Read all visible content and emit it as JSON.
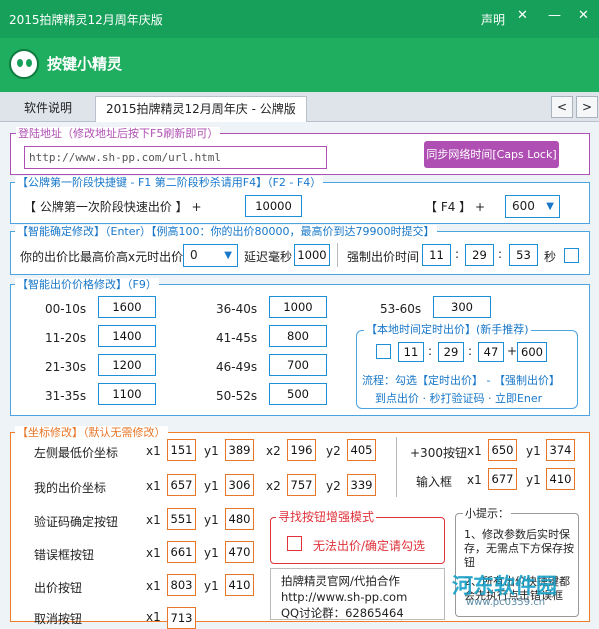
{
  "window": {
    "title": "2015拍牌精灵12月周年庆版",
    "menu": "声明"
  },
  "brand": {
    "name": "按键小精灵"
  },
  "tabs": [
    {
      "label": "软件说明"
    },
    {
      "label": "2015拍牌精灵12月周年庆 - 公牌版"
    }
  ],
  "nav": {
    "prev": "<",
    "next": ">"
  },
  "login": {
    "legend": "登陆地址（修改地址后按下F5刷新即可）",
    "url": "http://www.sh-pp.com/url.html",
    "sync_button": "同步网络时间[Caps Lock]"
  },
  "hotkey": {
    "legend_a": "【公牌第一阶段快捷键 - F1 第二阶段秒杀请用F4】",
    "legend_b": "（F2 - F4）",
    "label": "【 公牌第一次阶段快速出价 】 +",
    "value": "10000",
    "f4_label": "【  F4  】  +",
    "f4_value": "600"
  },
  "smart": {
    "legend_a": "【智能确定修改】（Enter）",
    "legend_b": "【例高100：你的出价80000，最高价到达79900时提交】",
    "label_prefix": "你的出价比最高价高x元时出价",
    "select": "0",
    "delay_label": "延迟毫秒",
    "delay": "1000",
    "force_label": "强制出价时间",
    "h": "11",
    "m": "29",
    "s": "53",
    "sec_label": "秒"
  },
  "price": {
    "legend_a": "【智能出价价格修改】",
    "legend_b": "（F9）",
    "rows": [
      {
        "label": "00-10s",
        "value": "1600"
      },
      {
        "label": "11-20s",
        "value": "1400"
      },
      {
        "label": "21-30s",
        "value": "1200"
      },
      {
        "label": "31-35s",
        "value": "1100"
      },
      {
        "label": "36-40s",
        "value": "1000"
      },
      {
        "label": "41-45s",
        "value": "800"
      },
      {
        "label": "46-49s",
        "value": "700"
      },
      {
        "label": "50-52s",
        "value": "500"
      },
      {
        "label": "53-60s",
        "value": "300"
      }
    ]
  },
  "timer": {
    "legend": "【本地时间定时出价】(新手推荐)",
    "h": "11",
    "m": "29",
    "s": "47",
    "add": "600",
    "flow_a": "流程：勾选【定时出价】 - 【强制出价】",
    "flow_b": "到点出价 · 秒打验证码 · 立即Ener"
  },
  "coords": {
    "legend": "【坐标修改】（默认无需修改）",
    "rows": [
      {
        "label": "左侧最低价坐标",
        "x1": "151",
        "y1": "389",
        "x2": "196",
        "y2": "405"
      },
      {
        "label": "我的出价坐标",
        "x1": "657",
        "y1": "306",
        "x2": "757",
        "y2": "339"
      },
      {
        "label": "验证码确定按钮",
        "x1": "551",
        "y1": "480"
      },
      {
        "label": "错误框按钮",
        "x1": "661",
        "y1": "470"
      },
      {
        "label": "出价按钮",
        "x1": "803",
        "y1": "410"
      },
      {
        "label": "取消按钮",
        "x1": "713",
        "y1": "..."
      }
    ],
    "right": [
      {
        "label": "+300按钮",
        "x1": "650",
        "y1": "374"
      },
      {
        "label": "输入框",
        "x1": "677",
        "y1": "410"
      }
    ],
    "tags": {
      "x1": "x1",
      "y1": "y1",
      "x2": "x2",
      "y2": "y2"
    }
  },
  "enhance": {
    "legend": "寻找按钮增强模式",
    "check_label": "无法出价/确定请勾选"
  },
  "info": {
    "line1": "拍牌精灵官网/代拍合作",
    "line2": "http://www.sh-pp.com",
    "line3": "QQ讨论群：62865464"
  },
  "tips": {
    "legend": "小提示：",
    "text1": "1、修改参数后实时保存，无需点下方保存按钮",
    "text2": "2、所有出价快捷键都会先执行点击错误框"
  },
  "watermark": {
    "text": "河东软件园",
    "sub": "www.pc0359.cn"
  }
}
